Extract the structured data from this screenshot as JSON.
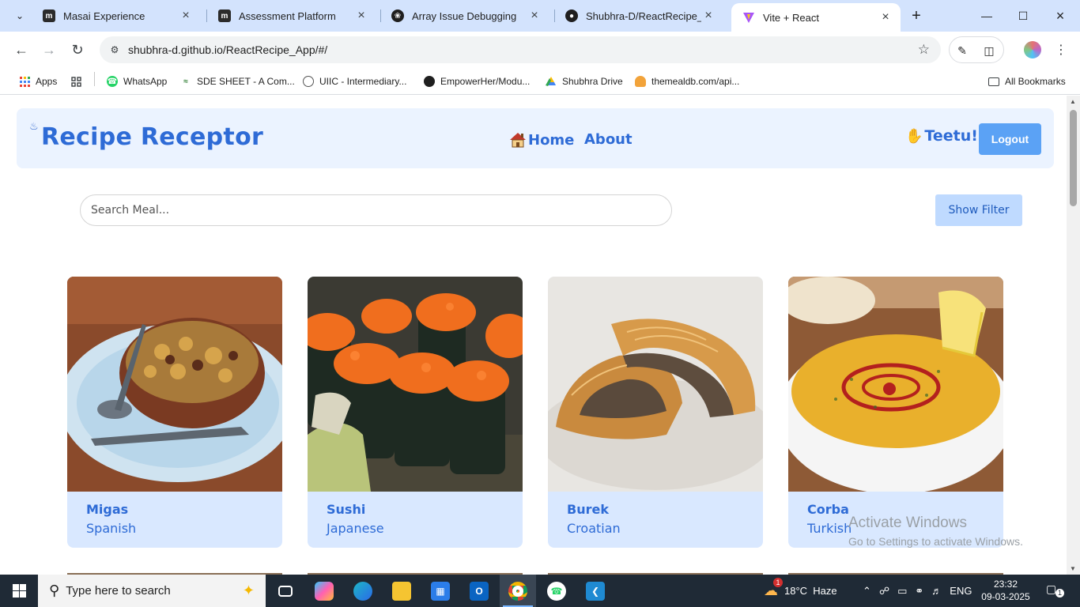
{
  "browser": {
    "tabs": [
      {
        "title": "Masai Experience",
        "favicon": "m"
      },
      {
        "title": "Assessment Platform",
        "favicon": "m"
      },
      {
        "title": "Array Issue Debugging",
        "favicon": "chatgpt"
      },
      {
        "title": "Shubhra-D/ReactRecipe_Ap",
        "favicon": "github"
      },
      {
        "title": "Vite + React",
        "favicon": "vite"
      }
    ],
    "active_tab": 4,
    "url": "shubhra-d.github.io/ReactRecipe_App/#/",
    "bookmarks": [
      {
        "label": "Apps",
        "icon": "apps-grid-icon"
      },
      {
        "label": "",
        "icon": "tiles-icon"
      },
      {
        "label": "WhatsApp",
        "icon": "whatsapp-icon"
      },
      {
        "label": "SDE SHEET - A Com...",
        "icon": "sde-icon"
      },
      {
        "label": "UIIC - Intermediary...",
        "icon": "globe-icon"
      },
      {
        "label": "EmpowerHer/Modu...",
        "icon": "github-icon"
      },
      {
        "label": "Shubhra Drive",
        "icon": "drive-icon"
      },
      {
        "label": "themealdb.com/api...",
        "icon": "meal-icon"
      }
    ],
    "all_bookmarks_label": "All Bookmarks"
  },
  "app": {
    "brand": "Recipe Receptor",
    "nav": {
      "home": "Home",
      "about": "About"
    },
    "greeting": "Teetu!",
    "logout_label": "Logout",
    "search_placeholder": "Search Meal...",
    "filter_label": "Show Filter",
    "meals": [
      {
        "name": "Migas",
        "area": "Spanish",
        "image": "migas-dish"
      },
      {
        "name": "Sushi",
        "area": "Japanese",
        "image": "sushi-rolls"
      },
      {
        "name": "Burek",
        "area": "Croatian",
        "image": "burek-pastry"
      },
      {
        "name": "Corba",
        "area": "Turkish",
        "image": "corba-soup"
      }
    ]
  },
  "watermark": {
    "line1": "Activate Windows",
    "line2": "Go to Settings to activate Windows."
  },
  "taskbar": {
    "search_placeholder": "Type here to search",
    "weather": "18°C  Haze",
    "weather_badge": "1",
    "language": "ENG",
    "time": "23:32",
    "date": "09-03-2025",
    "notification_count": "1"
  },
  "colors": {
    "accent": "#2e6bd6",
    "nav_bg": "#ebf3ff",
    "card_bg": "#d9e8ff",
    "logout_bg": "#5ba2f5",
    "filter_bg": "#bfdaff"
  }
}
